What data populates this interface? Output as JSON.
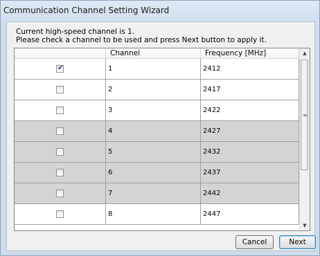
{
  "window": {
    "title": "Communication Channel Setting Wizard"
  },
  "intro": {
    "line1": "Current high-speed channel is 1.",
    "line2": "Please check a channel to be used and press Next button to apply it."
  },
  "grid": {
    "columns": [
      "",
      "Channel",
      "Frequency [MHz]"
    ],
    "rows": [
      {
        "checked": true,
        "channel": "1",
        "frequency": "2412",
        "shaded": false
      },
      {
        "checked": false,
        "channel": "2",
        "frequency": "2417",
        "shaded": false
      },
      {
        "checked": false,
        "channel": "3",
        "frequency": "2422",
        "shaded": false
      },
      {
        "checked": false,
        "channel": "4",
        "frequency": "2427",
        "shaded": true
      },
      {
        "checked": false,
        "channel": "5",
        "frequency": "2432",
        "shaded": true
      },
      {
        "checked": false,
        "channel": "6",
        "frequency": "2437",
        "shaded": true
      },
      {
        "checked": false,
        "channel": "7",
        "frequency": "2442",
        "shaded": true
      },
      {
        "checked": false,
        "channel": "8",
        "frequency": "2447",
        "shaded": false
      }
    ]
  },
  "buttons": {
    "cancel": "Cancel",
    "next": "Next"
  },
  "icons": {
    "checkmark": "check-icon",
    "scroll_up": "arrow-up-icon",
    "scroll_down": "arrow-down-icon",
    "grip": "grip-icon"
  },
  "colors": {
    "shaded_row": "#d4d4d4",
    "titlebar": "#dfe9f5",
    "default_button_border": "#3c7fb1"
  }
}
